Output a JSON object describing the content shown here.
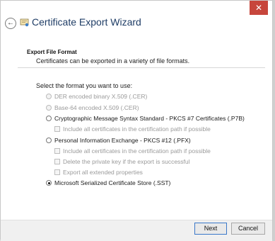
{
  "window": {
    "title": "Certificate Export Wizard",
    "close_glyph": "✕"
  },
  "section": {
    "title": "Export File Format",
    "subtitle": "Certificates can be exported in a variety of file formats."
  },
  "prompt": "Select the format you want to use:",
  "options": [
    {
      "label": "DER encoded binary X.509 (.CER)"
    },
    {
      "label": "Base-64 encoded X.509 (.CER)"
    },
    {
      "label": "Cryptographic Message Syntax Standard - PKCS #7 Certificates (.P7B)"
    },
    {
      "label": "Include all certificates in the certification path if possible"
    },
    {
      "label": "Personal Information Exchange - PKCS #12 (.PFX)"
    },
    {
      "label": "Include all certificates in the certification path if possible"
    },
    {
      "label": "Delete the private key if the export is successful"
    },
    {
      "label": "Export all extended properties"
    },
    {
      "label": "Microsoft Serialized Certificate Store (.SST)"
    }
  ],
  "buttons": {
    "next": "Next",
    "cancel": "Cancel"
  },
  "icons": {
    "back": "back-arrow-icon",
    "certificate": "certificate-icon"
  }
}
